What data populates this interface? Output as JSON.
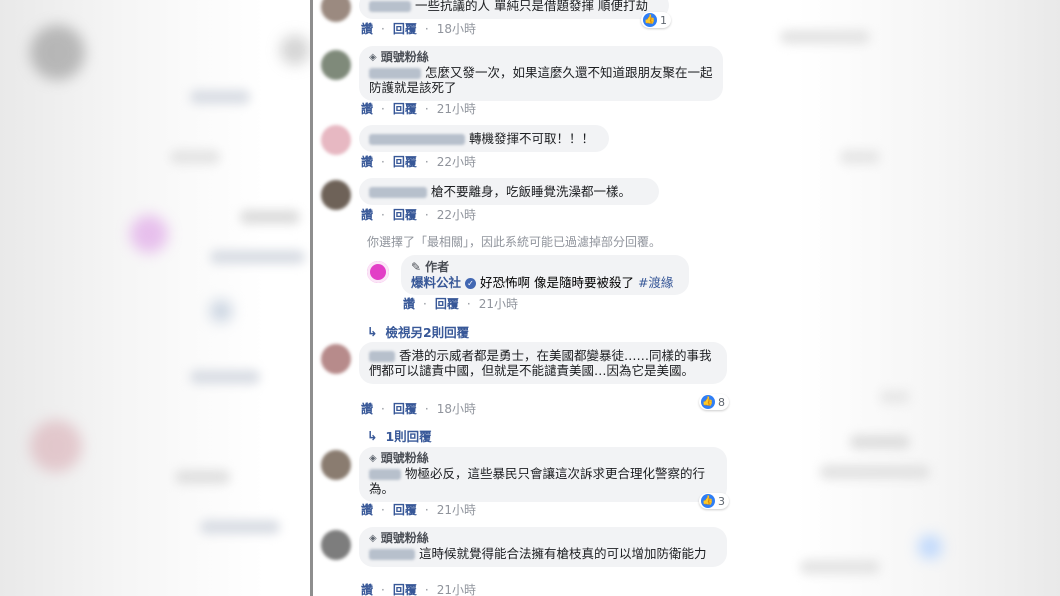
{
  "comments": [
    {
      "text": "一些抗議的人 單純只是借題發揮 順便打劫",
      "actions": {
        "like": "讚",
        "reply": "回覆",
        "time": "18小時"
      },
      "reactions": "1"
    },
    {
      "badge": "頭號粉絲",
      "text": "怎麼又發一次，如果這麼久還不知道跟朋友聚在一起防護就是該死了",
      "actions": {
        "like": "讚",
        "reply": "回覆",
        "time": "21小時"
      }
    },
    {
      "text": "轉機發揮不可取！！！",
      "actions": {
        "like": "讚",
        "reply": "回覆",
        "time": "22小時"
      }
    },
    {
      "text": "槍不要離身，吃飯睡覺洗澡都一樣。",
      "actions": {
        "like": "讚",
        "reply": "回覆",
        "time": "22小時"
      }
    },
    {
      "text": "香港的示威者都是勇士，在美國都變暴徒……同樣的事我們都可以譴責中國，但就是不能譴責美國…因為它是美國。",
      "actions": {
        "like": "讚",
        "reply": "回覆",
        "time": "18小時"
      },
      "reactions": "8"
    },
    {
      "badge": "頭號粉絲",
      "text": "物極必反，這些暴民只會讓這次訴求更合理化警察的行為。",
      "actions": {
        "like": "讚",
        "reply": "回覆",
        "time": "21小時"
      },
      "reactions": "3"
    },
    {
      "badge": "頭號粉絲",
      "text": "這時候就覺得能合法擁有槍枝真的可以增加防衛能力",
      "actions": {
        "like": "讚",
        "reply": "回覆",
        "time": "21小時"
      }
    }
  ],
  "filter_notice": "你選擇了「最相關」，因此系統可能已過濾掉部分回覆。",
  "author_reply": {
    "role": "作者",
    "page_name": "爆料公社",
    "text": "好恐怖啊 像是隨時要被殺了",
    "hashtag": "#渡緣",
    "actions": {
      "like": "讚",
      "reply": "回覆",
      "time": "21小時"
    }
  },
  "view_more_replies": "檢視另2則回覆",
  "one_reply": "1則回覆",
  "colors": {
    "link": "#385898",
    "bubble": "#f2f3f5",
    "meta": "#90949c",
    "like": "#2f7ef5"
  }
}
